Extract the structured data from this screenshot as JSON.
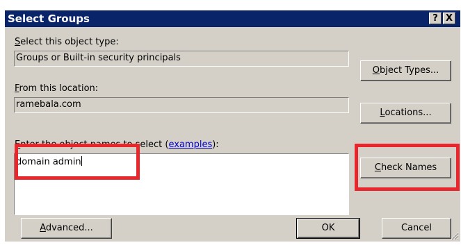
{
  "window": {
    "title": "Select Groups",
    "help_button": "?",
    "close_button": "X"
  },
  "object_type": {
    "label_accel": "S",
    "label_rest": "elect this object type:",
    "value": "Groups or Built-in security principals",
    "button_accel": "O",
    "button_rest": "bject Types..."
  },
  "location": {
    "label_accel": "F",
    "label_rest": "rom this location:",
    "value": "ramebala.com",
    "button_accel": "L",
    "button_rest": "ocations..."
  },
  "names": {
    "label_accel": "E",
    "label_rest": "nter the object names to select (",
    "link_text": "examples",
    "label_end": "):",
    "value": "domain admin",
    "check_accel": "C",
    "check_rest": "heck Names"
  },
  "footer": {
    "advanced_accel": "A",
    "advanced_rest": "dvanced...",
    "ok_label": "OK",
    "cancel_label": "Cancel"
  },
  "colors": {
    "title_bar": "#0a246a",
    "dialog_face": "#d4d0c8",
    "annotation_red": "#e8262b",
    "link": "#0000cc"
  }
}
